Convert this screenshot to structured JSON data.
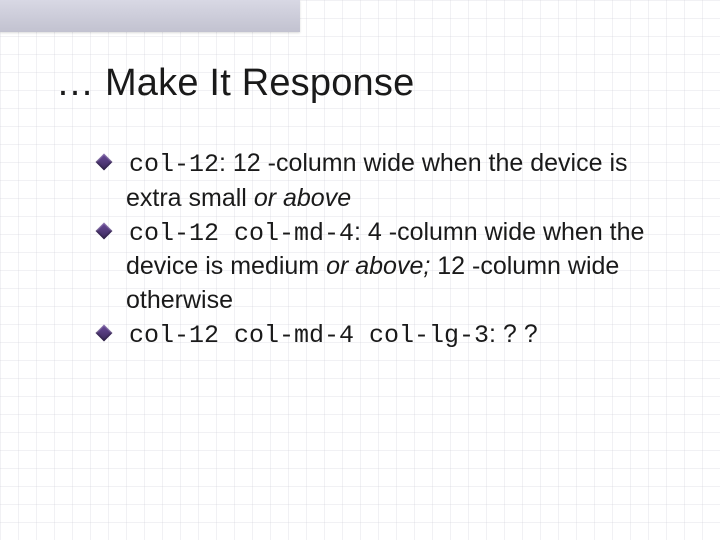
{
  "title": "… Make It Response",
  "bullets": [
    {
      "code": "col-12",
      "text_after_code": ": 12 -column wide when the device is extra small ",
      "italic_tail": "or above"
    },
    {
      "code": "col-12 col-md-4",
      "text_after_code": ": 4 -column wide when the device is medium ",
      "italic_tail": "or above;",
      "text_after_italic": " 12 -column wide otherwise"
    },
    {
      "code": "col-12 col-md-4 col-lg-3",
      "text_after_code": ": ? ?"
    }
  ]
}
